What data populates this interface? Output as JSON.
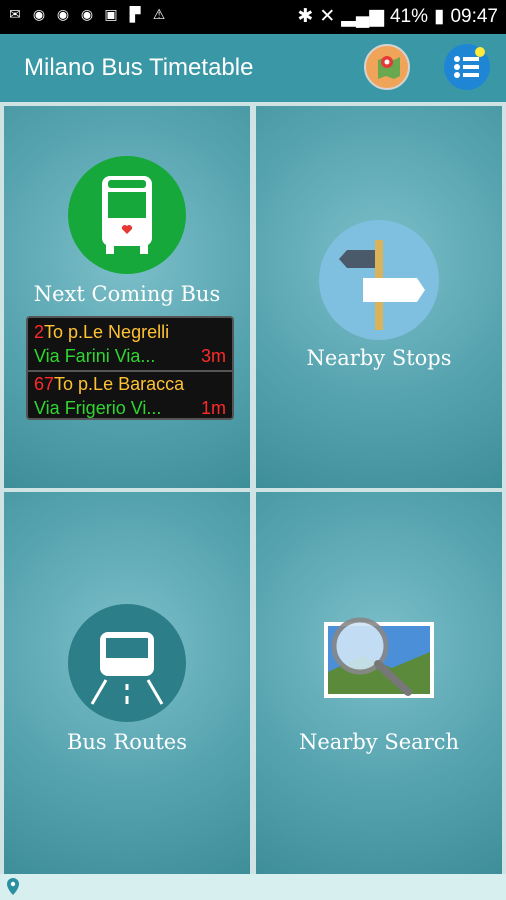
{
  "status_bar": {
    "icons_left": [
      "gmail-icon",
      "chrome-icon",
      "chrome-icon",
      "chrome-icon",
      "image-icon",
      "flipboard-icon",
      "warning-icon"
    ],
    "battery": "41%",
    "time": "09:47"
  },
  "app_bar": {
    "title": "Milano Bus Timetable"
  },
  "tiles": {
    "next_bus": {
      "label": "Next Coming Bus",
      "arrivals": [
        {
          "line": "2",
          "destination": "To p.Le Negrelli",
          "via": "Via Farini Via...",
          "eta": "3m"
        },
        {
          "line": "67",
          "destination": "To p.Le Baracca",
          "via": "Via Frigerio Vi...",
          "eta": "1m"
        }
      ]
    },
    "nearby_stops": {
      "label": "Nearby Stops"
    },
    "bus_routes": {
      "label": "Bus Routes"
    },
    "nearby_search": {
      "label": "Nearby Search"
    }
  },
  "colors": {
    "app_bar": "#3a98a6",
    "tile": "#55a3af",
    "line_number": "#ff2a2a",
    "destination": "#ffc233",
    "via": "#30d630"
  }
}
